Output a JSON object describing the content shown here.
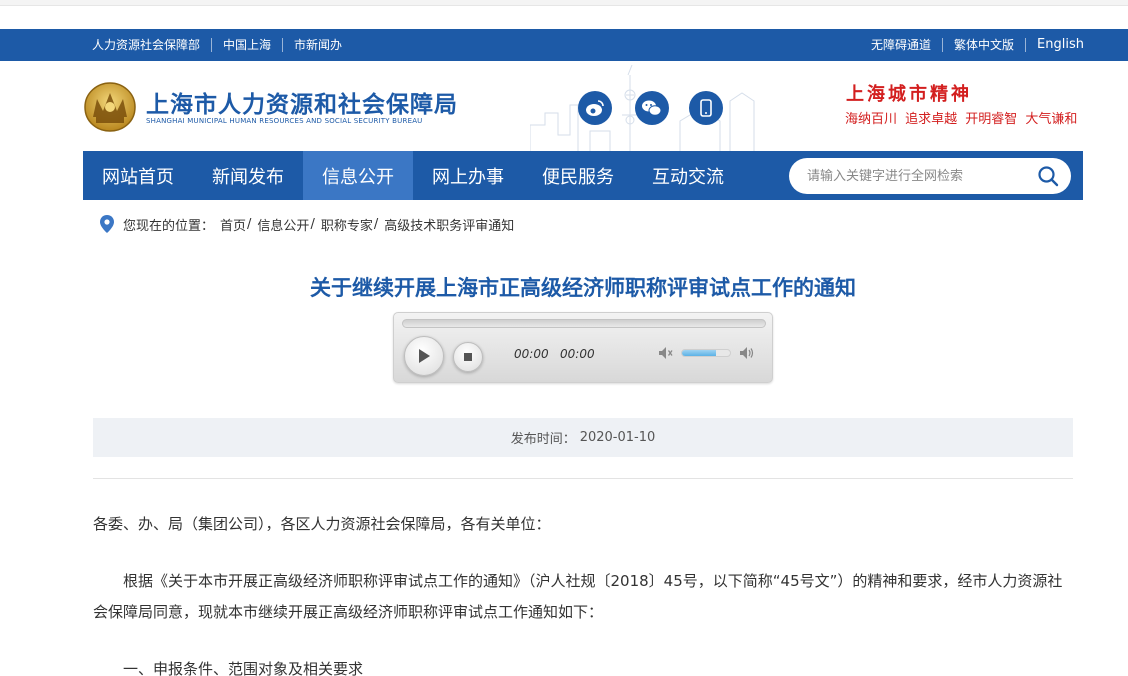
{
  "topbar": {
    "left_links": [
      "人力资源社会保障部",
      "中国上海",
      "市新闻办"
    ],
    "right_links": [
      "无障碍通道",
      "繁体中文版",
      "English"
    ]
  },
  "header": {
    "title": "上海市人力资源和社会保障局",
    "subtitle": "SHANGHAI MUNICIPAL HUMAN RESOURCES AND SOCIAL SECURITY BUREAU",
    "spirit_title": "上海城市精神",
    "spirit_words": "海纳百川  追求卓越  开明睿智  大气谦和",
    "social_icons": [
      "weibo-icon",
      "wechat-icon",
      "mobile-icon"
    ]
  },
  "nav": {
    "items": [
      "网站首页",
      "新闻发布",
      "信息公开",
      "网上办事",
      "便民服务",
      "互动交流"
    ],
    "active": "信息公开",
    "search_placeholder": "请输入关键字进行全网检索"
  },
  "breadcrumb": {
    "label": "您现在的位置：",
    "items": [
      "首页",
      "信息公开",
      "职称专家",
      "高级技术职务评审通知"
    ]
  },
  "article": {
    "title": "关于继续开展上海市正高级经济师职称评审试点工作的通知",
    "player": {
      "current_time": "00:00",
      "total_time": "00:00",
      "volume": 0.7
    },
    "publish_label": "发布时间：",
    "publish_date": "2020-01-10",
    "paragraphs": [
      "各委、办、局（集团公司），各区人力资源社会保障局，各有关单位：",
      "根据《关于本市开展正高级经济师职称评审试点工作的通知》（沪人社规〔2018〕45号，以下简称“45号文”）的精神和要求，经市人力资源社会保障局同意，现就本市继续开展正高级经济师职称评审试点工作通知如下：",
      "一、申报条件、范围对象及相关要求"
    ]
  },
  "colors": {
    "brand_blue": "#1d5aa7",
    "nav_active": "#3b77c5",
    "spirit_red": "#d31f1f"
  }
}
